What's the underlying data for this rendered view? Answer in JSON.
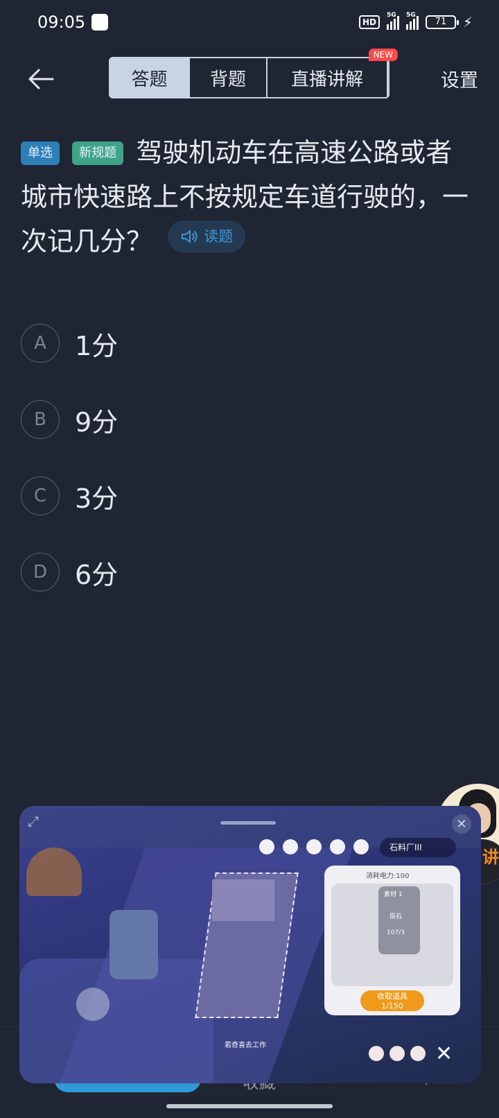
{
  "status_bar": {
    "time": "09:05",
    "hd_label": "HD",
    "signal1_label": "5G",
    "signal2_label": "5G",
    "battery": "71"
  },
  "nav": {
    "tabs": [
      {
        "label": "答题",
        "active": true
      },
      {
        "label": "背题",
        "active": false
      },
      {
        "label": "直播讲解",
        "active": false
      }
    ],
    "new_badge": "NEW",
    "settings_label": "设置"
  },
  "question": {
    "type_tag": "单选",
    "rule_tag": "新规题",
    "text": "驾驶机动车在高速公路或者城市快速路上不按规定车道行驶的，一次记几分？",
    "read_button": "读题"
  },
  "options": [
    {
      "letter": "A",
      "text": "1分"
    },
    {
      "letter": "B",
      "text": "9分"
    },
    {
      "letter": "C",
      "text": "3分"
    },
    {
      "letter": "D",
      "text": "6分"
    }
  ],
  "bottom": {
    "favorite_label": "收藏",
    "counter": "1/500"
  },
  "video": {
    "label": "讲"
  },
  "game_overlay": {
    "building_title": "石料厂III",
    "power_label": "消耗电力:100",
    "material_label": "素材 1",
    "stone_label": "原石",
    "amount": "107/3",
    "collect_label": "收取道具",
    "collect_count": "1/150",
    "work_label": "若奇喜去工作"
  },
  "colors": {
    "background": "#1f2532",
    "active_tab": "#c8d3e4",
    "tag_single": "#2d7fb8",
    "tag_new": "#3fa389",
    "new_badge": "#ff4b4b",
    "read_button_text": "#3f95d6"
  }
}
